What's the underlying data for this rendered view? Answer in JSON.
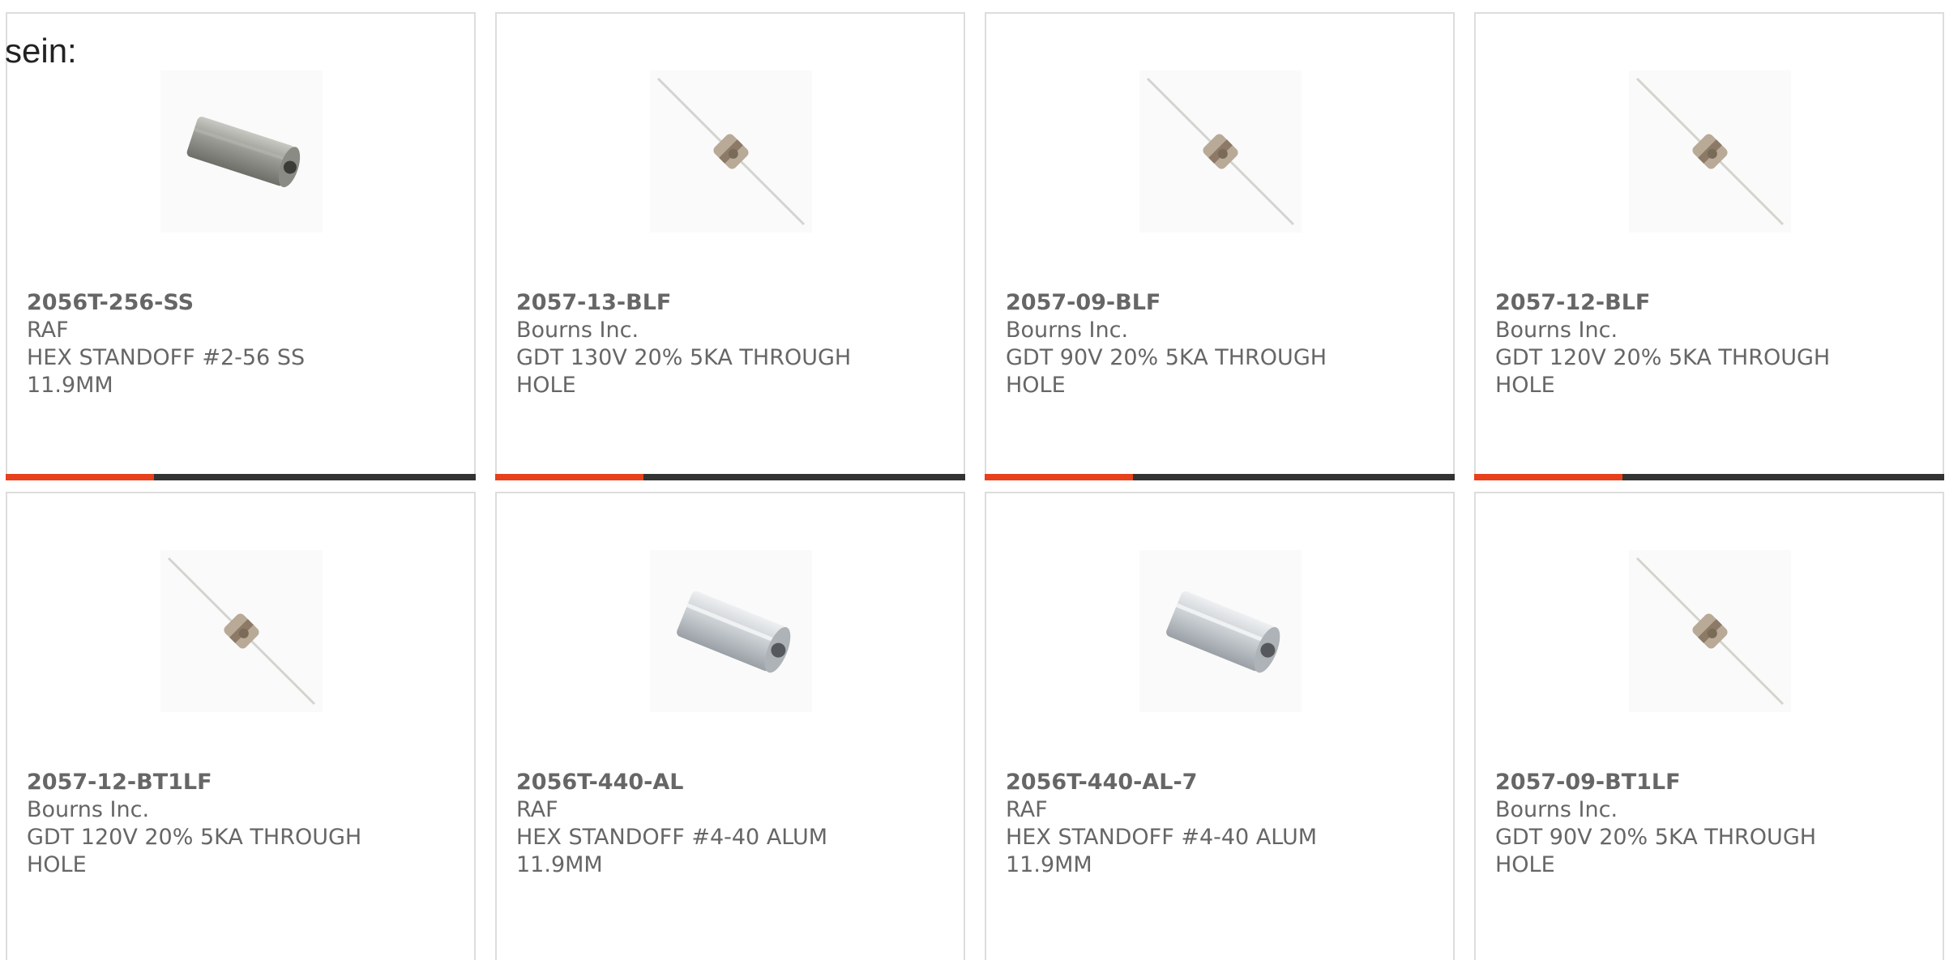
{
  "heading_fragment": "sein:",
  "colors": {
    "accent": "#e8401c",
    "bar": "#333333",
    "border": "#dddddd",
    "text": "#666666"
  },
  "products": [
    {
      "part_number": "2056T-256-SS",
      "manufacturer": "RAF",
      "description": "HEX STANDOFF #2-56 SS 11.9MM",
      "image": "hex-standoff-steel"
    },
    {
      "part_number": "2057-13-BLF",
      "manufacturer": "Bourns Inc.",
      "description": "GDT 130V 20% 5KA THROUGH HOLE",
      "image": "gas-discharge-tube"
    },
    {
      "part_number": "2057-09-BLF",
      "manufacturer": "Bourns Inc.",
      "description": "GDT 90V 20% 5KA THROUGH HOLE",
      "image": "gas-discharge-tube"
    },
    {
      "part_number": "2057-12-BLF",
      "manufacturer": "Bourns Inc.",
      "description": "GDT 120V 20% 5KA THROUGH HOLE",
      "image": "gas-discharge-tube"
    },
    {
      "part_number": "2057-12-BT1LF",
      "manufacturer": "Bourns Inc.",
      "description": "GDT 120V 20% 5KA THROUGH HOLE",
      "image": "gas-discharge-tube"
    },
    {
      "part_number": "2056T-440-AL",
      "manufacturer": "RAF",
      "description": "HEX STANDOFF #4-40 ALUM 11.9MM",
      "image": "hex-standoff-aluminum"
    },
    {
      "part_number": "2056T-440-AL-7",
      "manufacturer": "RAF",
      "description": "HEX STANDOFF #4-40 ALUM 11.9MM",
      "image": "hex-standoff-aluminum"
    },
    {
      "part_number": "2057-09-BT1LF",
      "manufacturer": "Bourns Inc.",
      "description": "GDT 90V 20% 5KA THROUGH HOLE",
      "image": "gas-discharge-tube"
    }
  ]
}
